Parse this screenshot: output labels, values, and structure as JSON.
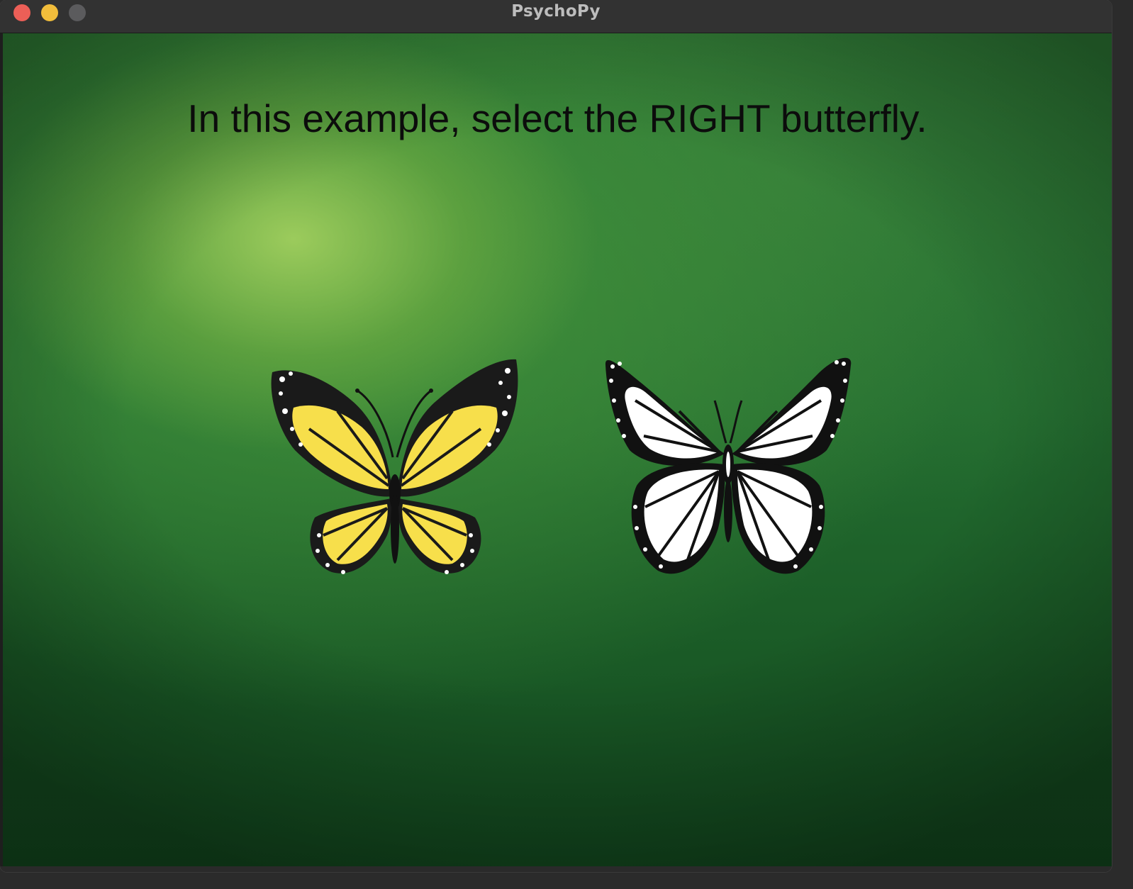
{
  "window": {
    "title": "PsychoPy",
    "controls": [
      "close-button",
      "minimize-button",
      "zoom-button"
    ]
  },
  "stage": {
    "instruction": "In this example, select the RIGHT butterfly."
  },
  "stimuli": [
    {
      "name": "left-butterfly",
      "wing_color": "#f7df4b",
      "style": "colored"
    },
    {
      "name": "right-butterfly",
      "wing_color": "#ffffff",
      "style": "black-and-white"
    }
  ],
  "colors": {
    "background_dark": "#1a5a26",
    "background_light": "#acd662",
    "text": "#0c0c0c"
  }
}
